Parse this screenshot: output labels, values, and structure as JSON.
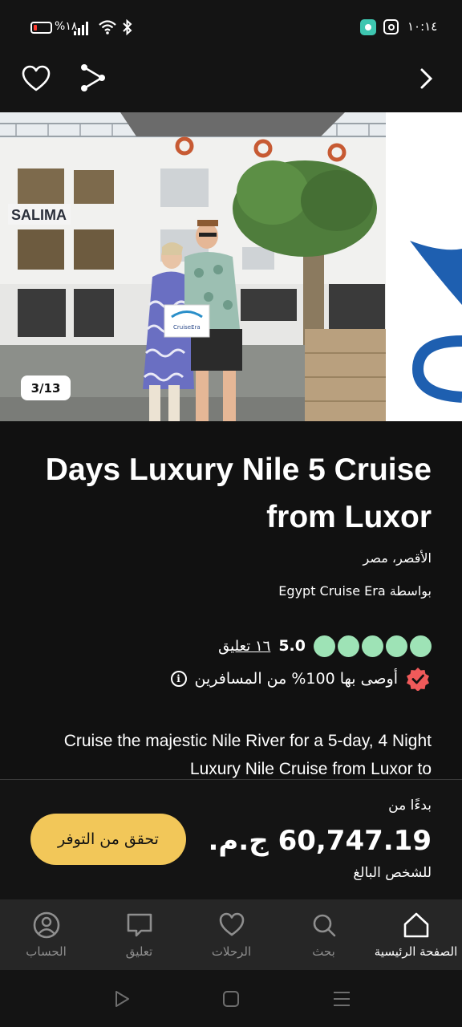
{
  "status_bar": {
    "battery_percent": "%١٨",
    "time": "١٠:١٤"
  },
  "gallery": {
    "counter": "3/13",
    "ship_sign": "SALIMA",
    "sign_text": "CruiseEra"
  },
  "listing": {
    "title": "Days Luxury Nile 5 Cruise from Luxor",
    "location": "الأقصر، مصر",
    "operator": "بواسطة Egypt Cruise Era",
    "rating_score": "5.0",
    "bubbles_filled": 5,
    "bubbles_total": 5,
    "review_count": "١٦ تعليق",
    "recommend_text": "أوصى بها 100% من المسافرين",
    "description": "Cruise the majestic Nile River for a 5-day, 4 Night Luxury Nile Cruise from Luxor to"
  },
  "price_bar": {
    "starting_label": "بدءًا من",
    "price": "60,747.19 ج.م.",
    "per_person": "للشخص البالغ",
    "check_button": "تحقق من التوفر"
  },
  "bottom_nav": {
    "items": [
      {
        "label": "الصفحة الرئيسية",
        "icon": "home-icon",
        "active": true
      },
      {
        "label": "بحث",
        "icon": "search-icon",
        "active": false
      },
      {
        "label": "الرحلات",
        "icon": "heart-icon",
        "active": false
      },
      {
        "label": "تعليق",
        "icon": "comment-icon",
        "active": false
      },
      {
        "label": "الحساب",
        "icon": "account-icon",
        "active": false
      }
    ]
  },
  "colors": {
    "background": "#111111",
    "bubble_green": "#9ee3b6",
    "cta_yellow": "#f2c759",
    "badge_red": "#f05a5a"
  }
}
